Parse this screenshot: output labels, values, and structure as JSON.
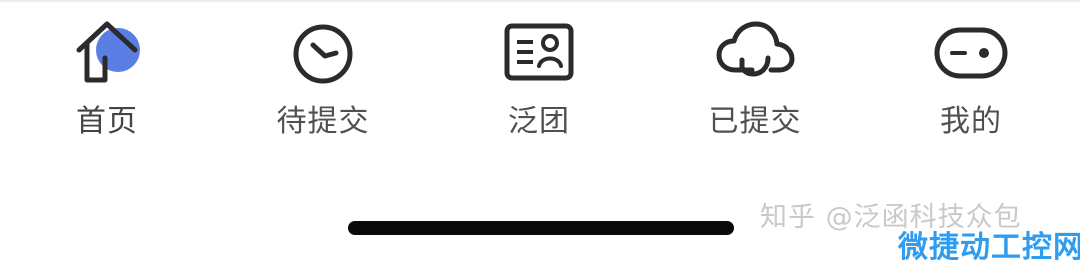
{
  "tabbar": {
    "accent_color": "#5b7ee5",
    "items": [
      {
        "label": "首页",
        "icon": "home-icon",
        "active": true
      },
      {
        "label": "待提交",
        "icon": "clock-icon",
        "active": false
      },
      {
        "label": "泛团",
        "icon": "id-card-icon",
        "active": false
      },
      {
        "label": "已提交",
        "icon": "cloud-sync-icon",
        "active": false
      },
      {
        "label": "我的",
        "icon": "toggle-face-icon",
        "active": false
      }
    ]
  },
  "watermarks": {
    "zhihu": "知乎 @泛函科技众包",
    "site": "微捷动工控网"
  }
}
